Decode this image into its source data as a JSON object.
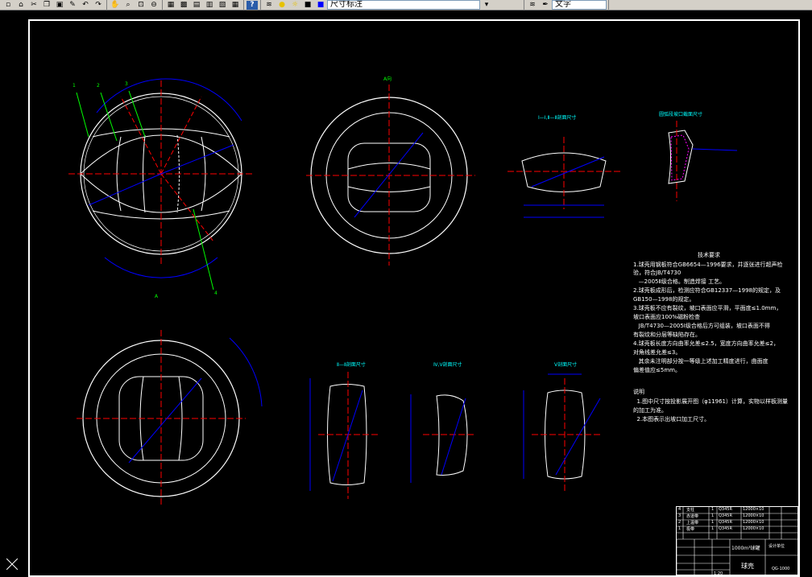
{
  "toolbar": {
    "dimension_style": "尺寸标注",
    "text_style": "文字"
  },
  "icons": {
    "standard": [
      "new-icon",
      "open-icon",
      "cut-icon",
      "copy-icon",
      "paste-icon",
      "match-icon",
      "undo-icon",
      "redo-icon",
      "pan-icon",
      "zoom-realtime-icon",
      "zoom-window-icon",
      "zoom-previous-icon",
      "properties-icon",
      "design-center-icon",
      "tool-palettes-icon",
      "sheet-set-icon",
      "markup-icon",
      "calculator-icon",
      "help-icon"
    ],
    "layers": [
      "layer-manager-icon",
      "bulb-icon",
      "sun-icon",
      "lock-icon",
      "color-swatch-icon"
    ],
    "styles": [
      "layer-previous-icon",
      "text-style-icon"
    ]
  },
  "drawing": {
    "labels": {
      "section_a": "A",
      "top_view_marker": "A向",
      "lbl_1": "1",
      "lbl_2": "2",
      "lbl_3": "3",
      "lbl_4": "4",
      "view_1": "Ⅰ—Ⅰ,Ⅱ—Ⅱ剖面尺寸",
      "view_2": "圆弧段坡口截面尺寸",
      "view_3": "Ⅱ—Ⅱ剖面尺寸",
      "view_4": "Ⅳ,Ⅴ剖面尺寸",
      "view_5": "Ⅴ剖面尺寸"
    },
    "tech_req": {
      "title": "技术要求",
      "lines": [
        "1.球壳用钢板符合GB6654—1996要求，并逐张进行超声检",
        "验，符合JB/T4730",
        "   —2005Ⅱ级合格。制造焊接 工艺。",
        "2.球壳板成形后，检测应符合GB12337—1998的规定，及",
        "GB150—1998的规定。",
        "3.球壳板不应有裂纹，坡口表面应平滑，平面度≤1.0mm，",
        "坡口表面应100%磁粉检查",
        "   JB/T4730—2005Ⅰ级合格后方可组装，坡口表面不得",
        "有裂纹和分层等缺陷存在。",
        "4.球壳板长度方向曲率允差≤2.5，宽度方向曲率允差≤2，",
        "对角线差允差≤3。",
        "   其余未注明部分按一等级上述加工精度进行，曲面度",
        "偏差值应≤5mm。"
      ],
      "note_title": "说明",
      "notes": [
        "  1.图中尺寸按投影展开图（φ11961）计算，实物以样板测量",
        "的加工为准。",
        "  2.本图表示出坡口加工尺寸。"
      ]
    },
    "title_block": {
      "r1": [
        "4",
        "支柱",
        "1",
        "Q345R",
        "12000×10",
        "",
        ""
      ],
      "r2": [
        "3",
        "赤道带",
        "1",
        "Q345R",
        "12000×10",
        "",
        ""
      ],
      "r3": [
        "2",
        "上温带",
        "1",
        "Q345R",
        "12000×10",
        "",
        ""
      ],
      "r4": [
        "1",
        "极带",
        "1",
        "Q345R",
        "12000×10",
        "",
        ""
      ],
      "name": "1000m³球罐",
      "subtitle": "球壳",
      "drawing_no": "QG-1000",
      "scale": "1:20",
      "company": "设计单位"
    }
  }
}
